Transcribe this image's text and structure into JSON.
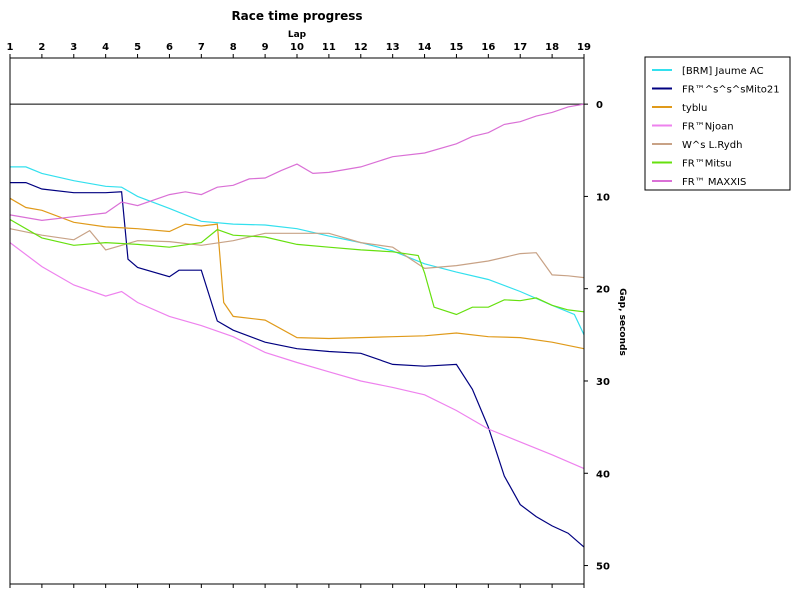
{
  "chart_data": {
    "type": "line",
    "title": "Race time progress",
    "xlabel": "Lap",
    "ylabel": "Gap, seconds",
    "x_ticks": [
      "1",
      "2",
      "3",
      "4",
      "5",
      "6",
      "7",
      "8",
      "9",
      "10",
      "11",
      "12",
      "13",
      "14",
      "15",
      "16",
      "17",
      "18",
      "19"
    ],
    "y_ticks": [
      "0",
      "10",
      "20",
      "30",
      "40",
      "50"
    ],
    "xlim": [
      1,
      19
    ],
    "ylim": [
      -5,
      52
    ],
    "y_inverted": true,
    "y_axis_side": "right",
    "x_axis_side": "top",
    "grid": false,
    "zero_line": true,
    "legend_position": "right",
    "series": [
      {
        "name": "[BRM] Jaume AC",
        "color": "#33e0ee",
        "x": [
          1,
          1.5,
          2,
          3,
          4,
          4.5,
          5,
          6,
          7,
          8,
          9,
          10,
          11,
          12,
          13,
          14,
          15,
          16,
          17,
          18,
          18.7,
          19
        ],
        "y": [
          6.8,
          6.8,
          7.5,
          8.3,
          8.9,
          9,
          10,
          11.3,
          12.7,
          13,
          13.1,
          13.5,
          14.3,
          15,
          15.9,
          17.3,
          18.2,
          19,
          20.3,
          21.8,
          22.8,
          25
        ]
      },
      {
        "name": "FR™^s^s^sMito21",
        "color": "#000080",
        "x": [
          1,
          1.5,
          2,
          3,
          4,
          4.5,
          4.7,
          5,
          6,
          6.3,
          7,
          7.5,
          8,
          9,
          10,
          11,
          12,
          13,
          14,
          15,
          15.5,
          16,
          16.5,
          17,
          17.5,
          18,
          18.5,
          19
        ],
        "y": [
          8.5,
          8.5,
          9.2,
          9.6,
          9.6,
          9.5,
          16.8,
          17.7,
          18.7,
          18,
          18,
          23.5,
          24.5,
          25.8,
          26.5,
          26.8,
          27,
          28.2,
          28.4,
          28.2,
          30.9,
          35,
          40.3,
          43.4,
          44.7,
          45.7,
          46.5,
          48
        ]
      },
      {
        "name": "tyblu",
        "color": "#e09a1a",
        "x": [
          1,
          1.5,
          2,
          3,
          4,
          5,
          6,
          6.5,
          7,
          7.5,
          7.7,
          8,
          9,
          10,
          11,
          12,
          13,
          14,
          15,
          16,
          17,
          18,
          19
        ],
        "y": [
          10.2,
          11.2,
          11.5,
          12.8,
          13.3,
          13.5,
          13.8,
          13,
          13.2,
          13,
          21.5,
          23,
          23.4,
          25.3,
          25.4,
          25.3,
          25.2,
          25.1,
          24.8,
          25.2,
          25.3,
          25.8,
          26.5
        ]
      },
      {
        "name": "FR™Njoan",
        "color": "#ee82ee",
        "x": [
          1,
          2,
          3,
          4,
          4.5,
          5,
          6,
          7,
          8,
          9,
          10,
          11,
          12,
          13,
          14,
          15,
          16,
          17,
          18,
          19
        ],
        "y": [
          15,
          17.6,
          19.6,
          20.8,
          20.3,
          21.5,
          23,
          24,
          25.2,
          26.9,
          28,
          29,
          30,
          30.7,
          31.5,
          33.2,
          35.2,
          36.6,
          38,
          39.5
        ]
      },
      {
        "name": "W^s L.Rydh",
        "color": "#c8a286",
        "x": [
          1,
          2,
          3,
          3.5,
          4,
          5,
          6,
          7,
          8,
          9,
          10,
          11,
          12,
          13,
          14,
          15,
          16,
          17,
          17.5,
          18,
          18.5,
          19
        ],
        "y": [
          13.5,
          14.2,
          14.7,
          13.7,
          15.8,
          14.8,
          14.9,
          15.3,
          14.8,
          14,
          14,
          14,
          15,
          15.5,
          17.8,
          17.5,
          17,
          16.2,
          16.1,
          18.5,
          18.6,
          18.8
        ]
      },
      {
        "name": "FR™Mitsu",
        "color": "#66e00e",
        "x": [
          1,
          2,
          3,
          4,
          5,
          6,
          7,
          7.5,
          8,
          9,
          10,
          11,
          12,
          13,
          13.8,
          14,
          14.3,
          15,
          15.5,
          16,
          16.5,
          17,
          17.5,
          18,
          18.5,
          19
        ],
        "y": [
          12.5,
          14.5,
          15.3,
          15,
          15.2,
          15.5,
          15,
          13.6,
          14.2,
          14.4,
          15.2,
          15.5,
          15.8,
          16,
          16.4,
          18.3,
          22,
          22.8,
          22,
          22,
          21.2,
          21.3,
          21,
          21.8,
          22.3,
          22.5
        ]
      },
      {
        "name": "FR™ MAXXIS",
        "color": "#da70d6",
        "x": [
          1,
          2,
          3,
          4,
          4.5,
          5,
          6,
          6.5,
          7,
          7.5,
          8,
          8.5,
          9,
          9.5,
          10,
          10.5,
          11,
          12,
          13,
          14,
          15,
          15.5,
          16,
          16.5,
          17,
          17.5,
          18,
          18.5,
          19
        ],
        "y": [
          12,
          12.6,
          12.2,
          11.8,
          10.6,
          11,
          9.8,
          9.5,
          9.8,
          9,
          8.8,
          8.1,
          8,
          7.2,
          6.5,
          7.5,
          7.4,
          6.8,
          5.7,
          5.3,
          4.3,
          3.5,
          3.1,
          2.2,
          1.9,
          1.3,
          0.9,
          0.3,
          0
        ]
      }
    ]
  }
}
